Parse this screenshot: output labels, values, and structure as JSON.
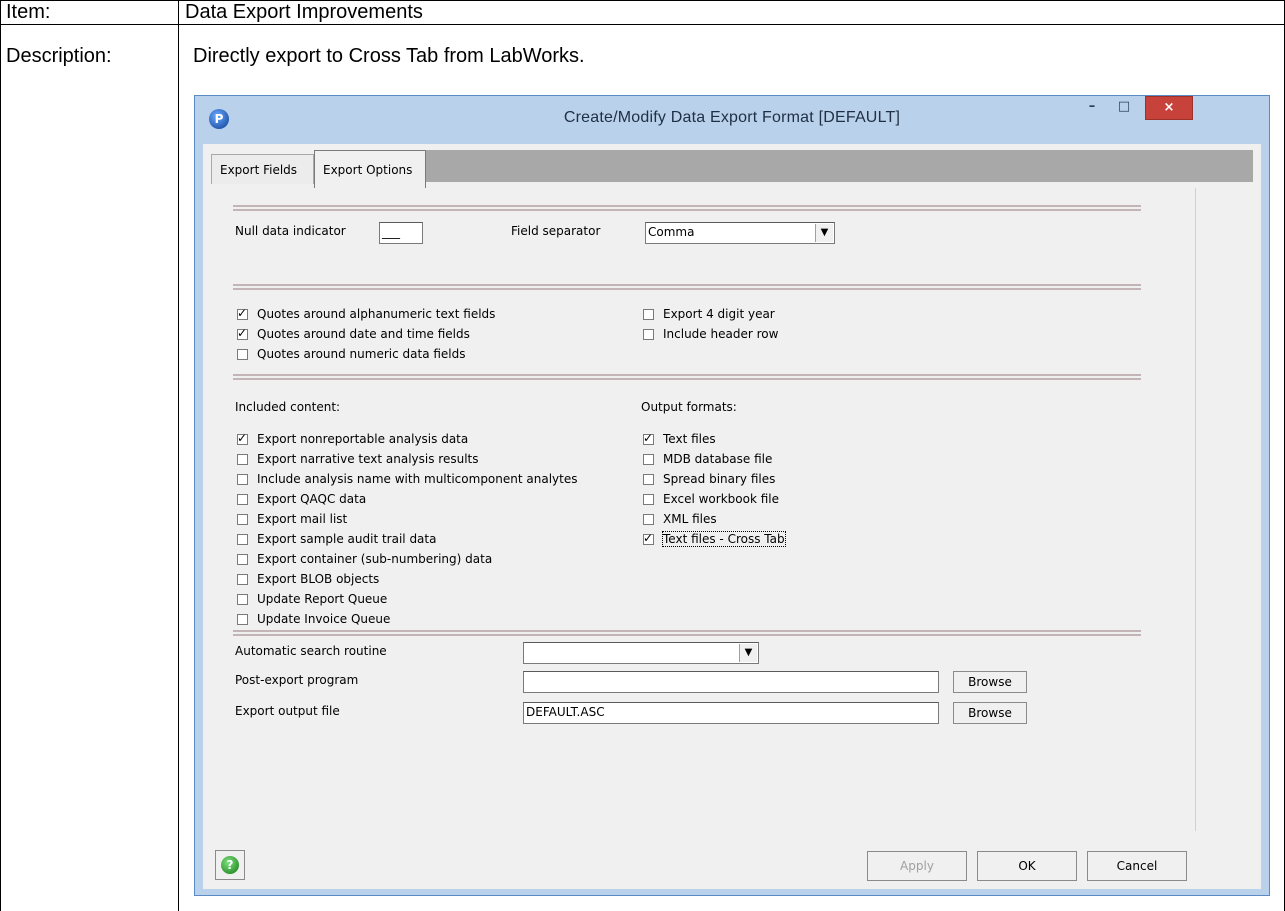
{
  "document": {
    "item_label": "Item:",
    "item_value": "Data Export Improvements",
    "description_label": "Description:",
    "description_value": "Directly export to Cross Tab from LabWorks."
  },
  "dialog": {
    "title": "Create/Modify Data Export Format   [DEFAULT]",
    "app_icon_glyph": "P",
    "controls": {
      "minimize": "–",
      "maximize": "□",
      "close": "×"
    },
    "tabs": {
      "fields": "Export Fields",
      "options": "Export Options"
    },
    "null_indicator": {
      "label": "Null data indicator",
      "value": "___"
    },
    "field_separator": {
      "label": "Field separator",
      "value": "Comma"
    },
    "quotes_options": [
      {
        "label": "Quotes around alphanumeric text fields",
        "checked": true
      },
      {
        "label": "Quotes around date and time fields",
        "checked": true
      },
      {
        "label": "Quotes around numeric data fields",
        "checked": false
      }
    ],
    "year_options": [
      {
        "label": "Export 4 digit year",
        "checked": false
      },
      {
        "label": "Include header row",
        "checked": false
      }
    ],
    "included_content": {
      "title": "Included content:",
      "items": [
        {
          "label": "Export nonreportable analysis data",
          "checked": true
        },
        {
          "label": "Export narrative text analysis results",
          "checked": false
        },
        {
          "label": "Include analysis name with multicomponent analytes",
          "checked": false
        },
        {
          "label": "Export QAQC data",
          "checked": false
        },
        {
          "label": "Export mail list",
          "checked": false
        },
        {
          "label": "Export sample audit trail data",
          "checked": false
        },
        {
          "label": "Export container (sub-numbering) data",
          "checked": false
        },
        {
          "label": "Export BLOB objects",
          "checked": false
        },
        {
          "label": "Update Report Queue",
          "checked": false
        },
        {
          "label": "Update Invoice Queue",
          "checked": false
        }
      ]
    },
    "output_formats": {
      "title": "Output formats:",
      "items": [
        {
          "label": "Text files",
          "checked": true
        },
        {
          "label": "MDB database file",
          "checked": false
        },
        {
          "label": "Spread binary files",
          "checked": false
        },
        {
          "label": "Excel workbook file",
          "checked": false
        },
        {
          "label": "XML files",
          "checked": false
        },
        {
          "label": "Text files - Cross Tab",
          "checked": true
        }
      ]
    },
    "auto_search": {
      "label": "Automatic search routine",
      "value": ""
    },
    "post_export": {
      "label": "Post-export program",
      "value": "",
      "browse": "Browse"
    },
    "output_file": {
      "label": "Export output file",
      "value": "DEFAULT.ASC",
      "browse": "Browse"
    },
    "footer": {
      "help_glyph": "?",
      "apply": "Apply",
      "ok": "OK",
      "cancel": "Cancel"
    }
  }
}
